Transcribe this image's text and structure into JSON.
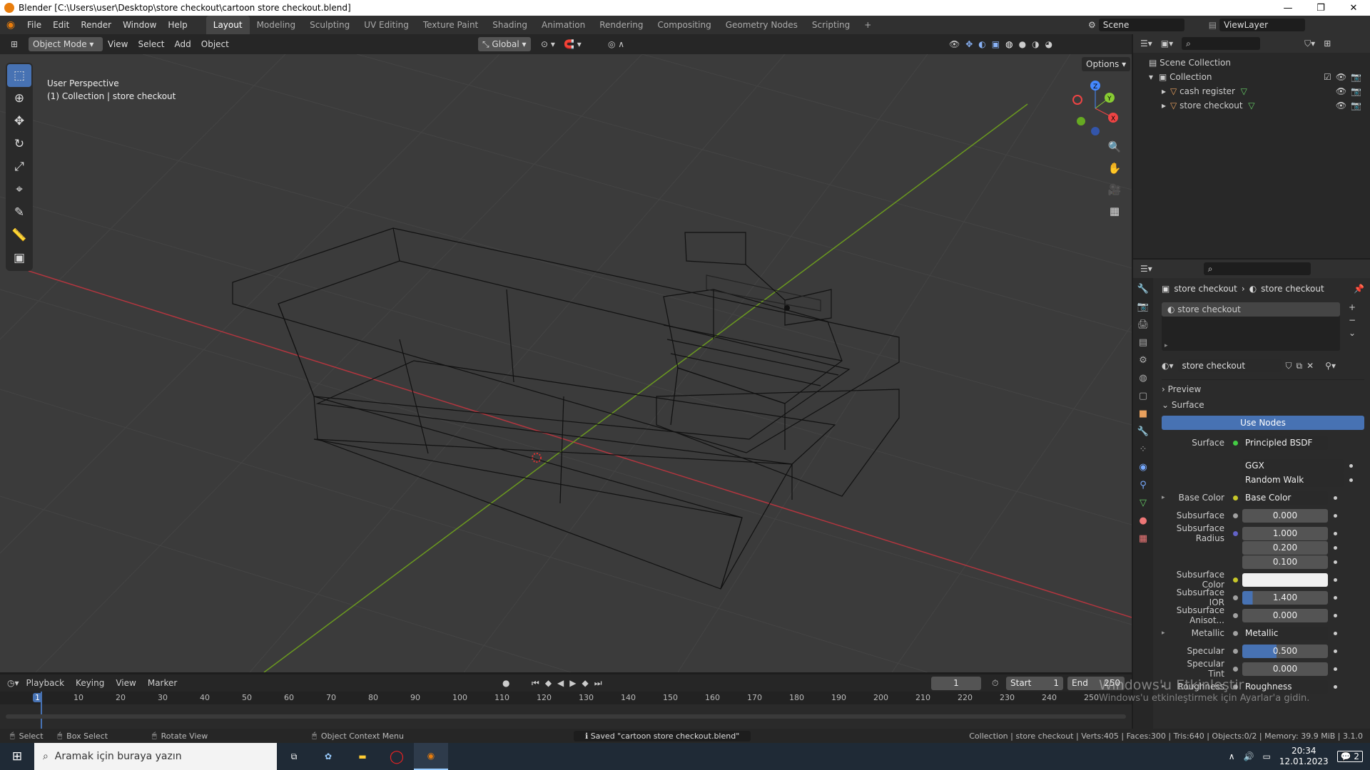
{
  "window": {
    "title": "Blender [C:\\Users\\user\\Desktop\\store checkout\\cartoon store checkout.blend]",
    "minimize": "—",
    "maximize": "❐",
    "close": "✕"
  },
  "menu": [
    "File",
    "Edit",
    "Render",
    "Window",
    "Help"
  ],
  "workspaces": [
    "Layout",
    "Modeling",
    "Sculpting",
    "UV Editing",
    "Texture Paint",
    "Shading",
    "Animation",
    "Rendering",
    "Compositing",
    "Geometry Nodes",
    "Scripting",
    "+"
  ],
  "scene": {
    "name": "Scene",
    "view_layer": "ViewLayer"
  },
  "viewport_header": {
    "mode": "Object Mode",
    "menus": [
      "View",
      "Select",
      "Add",
      "Object"
    ],
    "orientation": "Global",
    "options": "Options"
  },
  "viewport": {
    "perspective": "User Perspective",
    "collection_info": "(1) Collection | store checkout",
    "gizmo_axes": [
      "X",
      "Y",
      "Z"
    ]
  },
  "outliner": {
    "root": "Scene Collection",
    "collection": "Collection",
    "items": [
      "cash register",
      "store checkout"
    ]
  },
  "properties": {
    "breadcrumb": [
      "store checkout",
      "store checkout"
    ],
    "material_slot": "store checkout",
    "material_name": "store checkout",
    "panels": {
      "preview": "Preview",
      "surface": "Surface"
    },
    "use_nodes": "Use Nodes",
    "surface_label": "Surface",
    "surface_value": "Principled BSDF",
    "distribution": "GGX",
    "subsurface_method": "Random Walk",
    "fields": [
      {
        "label": "Base Color",
        "value": "Base Color",
        "kind": "link",
        "sock": "#c7c729",
        "expand": true
      },
      {
        "label": "Subsurface",
        "value": "0.000",
        "kind": "num",
        "sock": "#a1a1a1"
      },
      {
        "label": "Subsurface Radius",
        "value": "1.000",
        "kind": "num",
        "sock": "#6363c7"
      },
      {
        "label": "",
        "value": "0.200",
        "kind": "num"
      },
      {
        "label": "",
        "value": "0.100",
        "kind": "num"
      },
      {
        "label": "Subsurface Color",
        "value": "",
        "kind": "color",
        "sock": "#c7c729"
      },
      {
        "label": "Subsurface IOR",
        "value": "1.400",
        "kind": "slider",
        "sock": "#a1a1a1"
      },
      {
        "label": "Subsurface Anisot...",
        "value": "0.000",
        "kind": "num",
        "sock": "#a1a1a1"
      },
      {
        "label": "Metallic",
        "value": "Metallic",
        "kind": "link",
        "sock": "#a1a1a1",
        "expand": true
      },
      {
        "label": "Specular",
        "value": "0.500",
        "kind": "slider",
        "sock": "#a1a1a1"
      },
      {
        "label": "Specular Tint",
        "value": "0.000",
        "kind": "num",
        "sock": "#a1a1a1"
      },
      {
        "label": "Roughness",
        "value": "Roughness",
        "kind": "link",
        "sock": "#a1a1a1",
        "expand": true
      }
    ]
  },
  "timeline": {
    "menus": [
      "Playback",
      "Keying",
      "View",
      "Marker"
    ],
    "current_frame": "1",
    "start_label": "Start",
    "start": "1",
    "end_label": "End",
    "end": "250",
    "ticks": [
      "1",
      "10",
      "20",
      "30",
      "40",
      "50",
      "60",
      "70",
      "80",
      "90",
      "100",
      "110",
      "120",
      "130",
      "140",
      "150",
      "160",
      "170",
      "180",
      "190",
      "200",
      "210",
      "220",
      "230",
      "240",
      "250"
    ]
  },
  "statusbar": {
    "select": "Select",
    "box_select": "Box Select",
    "rotate": "Rotate View",
    "context": "Object Context Menu",
    "message": "Saved \"cartoon store checkout.blend\"",
    "stats": "Collection | store checkout | Verts:405 | Faces:300 | Tris:640 | Objects:0/2 | Memory: 39.9 MiB | 3.1.0"
  },
  "watermark": {
    "line1": "Windows'u Etkinleştir",
    "line2": "Windows'u etkinleştirmek için Ayarlar'a gidin."
  },
  "taskbar": {
    "search": "Aramak için buraya yazın",
    "time": "20:34",
    "date": "12.01.2023",
    "notif": "2"
  }
}
